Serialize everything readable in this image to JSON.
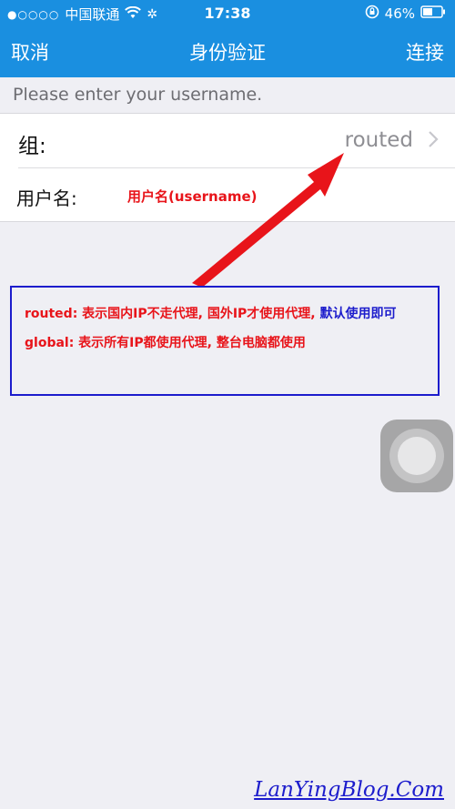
{
  "status_bar": {
    "signal": "●○○○○",
    "carrier": "中国联通",
    "time": "17:38",
    "battery_percent": "46%"
  },
  "nav": {
    "cancel_label": "取消",
    "title": "身份验证",
    "connect_label": "连接"
  },
  "hint": "Please enter your username.",
  "form": {
    "group_label": "组:",
    "group_value": "routed",
    "username_label": "用户名:",
    "username_annotation": "用户名(username)"
  },
  "note": {
    "line1_red": "routed: 表示国内IP不走代理, 国外IP才使用代理,",
    "line1_blue": " 默认使用即可",
    "line2": "global:  表示所有IP都使用代理, 整台电脑都使用"
  },
  "watermark": "LanYingBlog.Com",
  "colors": {
    "accent": "#1a8fe0",
    "annotation_red": "#e8141a",
    "annotation_blue": "#1c1ccc",
    "background": "#efeff4"
  },
  "icons": [
    "wifi-icon",
    "loading-icon",
    "rotation-lock-icon",
    "battery-icon",
    "chevron-right-icon",
    "assistive-touch-icon"
  ]
}
